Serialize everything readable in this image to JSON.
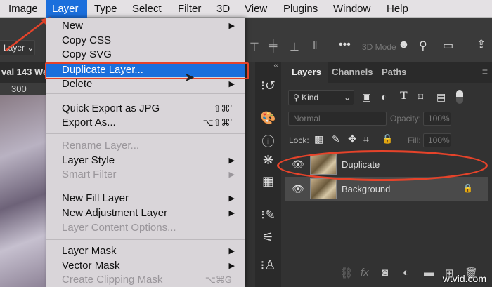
{
  "menubar": {
    "items": [
      "Image",
      "Layer",
      "Type",
      "Select",
      "Filter",
      "3D",
      "View",
      "Plugins",
      "Window",
      "Help"
    ],
    "active": "Layer"
  },
  "options": {
    "layer_select": "Layer",
    "mode_3d": "3D Mode"
  },
  "document": {
    "tab_title": "val 143 We",
    "ruler_mark": "300"
  },
  "layer_menu": {
    "new": "New",
    "copy_css": "Copy CSS",
    "copy_svg": "Copy SVG",
    "duplicate": "Duplicate Layer...",
    "delete": "Delete",
    "quick_export": "Quick Export as JPG",
    "quick_export_sc": "⇧⌘'",
    "export_as": "Export As...",
    "export_as_sc": "⌥⇧⌘'",
    "rename": "Rename Layer...",
    "layer_style": "Layer Style",
    "smart_filter": "Smart Filter",
    "new_fill": "New Fill Layer",
    "new_adjustment": "New Adjustment Layer",
    "content_options": "Layer Content Options...",
    "layer_mask": "Layer Mask",
    "vector_mask": "Vector Mask",
    "clipping_mask": "Create Clipping Mask",
    "clipping_mask_sc": "⌥⌘G"
  },
  "layers_panel": {
    "tabs": [
      "Layers",
      "Channels",
      "Paths"
    ],
    "filter": "Kind",
    "blend_mode": "Normal",
    "opacity_label": "Opacity:",
    "opacity": "100%",
    "lock_label": "Lock:",
    "fill_label": "Fill:",
    "fill": "100%",
    "layers": [
      {
        "name": "Duplicate",
        "visible": true
      },
      {
        "name": "Background",
        "visible": true,
        "locked": true
      }
    ]
  },
  "watermark": "wtvid.com",
  "colors": {
    "highlight": "#1b6fdc",
    "annotation": "#e5432a"
  }
}
